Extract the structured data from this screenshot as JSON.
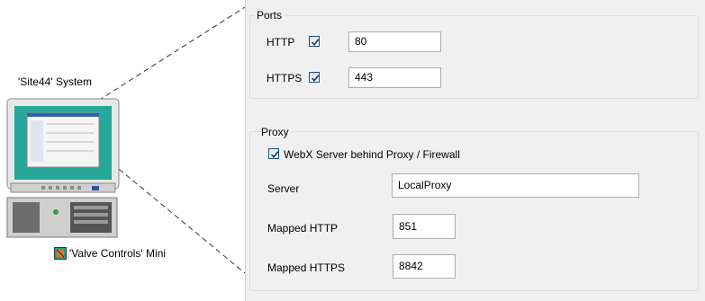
{
  "illustration": {
    "system_label": "'Site44' System",
    "mini_label": "'Valve Controls' Mini"
  },
  "ports": {
    "title": "Ports",
    "http_label": "HTTP",
    "http_checked": true,
    "http_value": "80",
    "https_label": "HTTPS",
    "https_checked": true,
    "https_value": "443"
  },
  "proxy": {
    "title": "Proxy",
    "behind_label": "WebX Server behind Proxy / Firewall",
    "behind_checked": true,
    "server_label": "Server",
    "server_value": "LocalProxy",
    "mapped_http_label": "Mapped HTTP",
    "mapped_http_value": "851",
    "mapped_https_label": "Mapped HTTPS",
    "mapped_https_value": "8842"
  }
}
